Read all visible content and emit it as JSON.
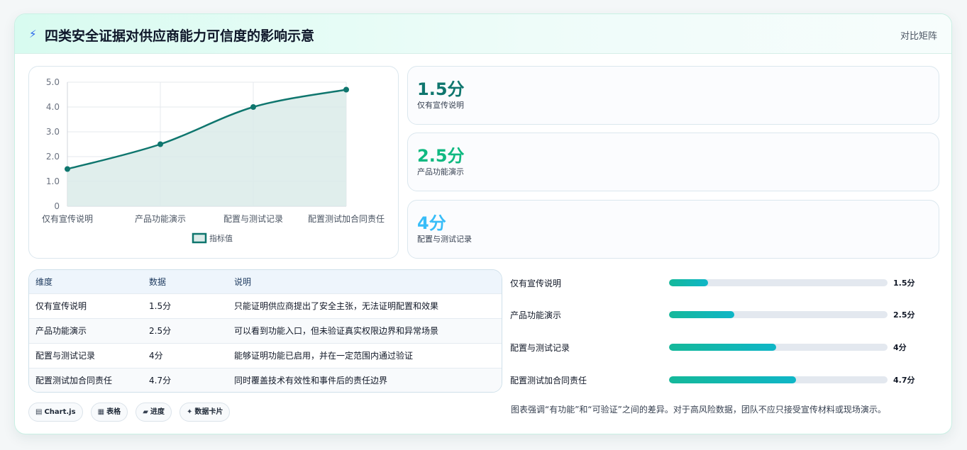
{
  "header": {
    "icon": "bolt-icon",
    "title": "四类安全证据对供应商能力可信度的影响示意",
    "tag": "对比矩阵"
  },
  "chart_data": {
    "type": "line",
    "categories": [
      "仅有宣传说明",
      "产品功能演示",
      "配置与测试记录",
      "配置测试加合同责任"
    ],
    "series": [
      {
        "name": "指标值",
        "values": [
          1.5,
          2.5,
          4,
          4.7
        ]
      }
    ],
    "ylim": [
      0,
      5
    ],
    "yticks": [
      "0",
      "1.0",
      "2.0",
      "3.0",
      "4.0",
      "5.0"
    ],
    "ytick_values": [
      0,
      1,
      2,
      3,
      4,
      5
    ],
    "grid": true,
    "legend": "bottom",
    "fill": true,
    "colors": {
      "line": "#0f766e",
      "area": "#dbebe9"
    }
  },
  "stats": [
    {
      "value": "1.5分",
      "label": "仅有宣传说明",
      "color": "#0f766e"
    },
    {
      "value": "2.5分",
      "label": "产品功能演示",
      "color": "#10b981"
    },
    {
      "value": "4分",
      "label": "配置与测试记录",
      "color": "#38bdf8"
    }
  ],
  "table": {
    "headers": [
      "维度",
      "数据",
      "说明"
    ],
    "rows": [
      [
        "仅有宣传说明",
        "1.5分",
        "只能证明供应商提出了安全主张，无法证明配置和效果"
      ],
      [
        "产品功能演示",
        "2.5分",
        "可以看到功能入口，但未验证真实权限边界和异常场景"
      ],
      [
        "配置与测试记录",
        "4分",
        "能够证明功能已启用，并在一定范围内通过验证"
      ],
      [
        "配置测试加合同责任",
        "4.7分",
        "同时覆盖技术有效性和事件后的责任边界"
      ]
    ]
  },
  "bars": [
    {
      "label": "仅有宣传说明",
      "value": "1.5分",
      "fraction": 0.18
    },
    {
      "label": "产品功能演示",
      "value": "2.5分",
      "fraction": 0.3
    },
    {
      "label": "配置与测试记录",
      "value": "4分",
      "fraction": 0.49
    },
    {
      "label": "配置测试加合同责任",
      "value": "4.7分",
      "fraction": 0.58
    }
  ],
  "chips": [
    {
      "icon": "▤",
      "label": "Chart.js"
    },
    {
      "icon": "▦",
      "label": "表格"
    },
    {
      "icon": "▰",
      "label": "进度"
    },
    {
      "icon": "✦",
      "label": "数据卡片"
    }
  ],
  "note": "图表强调“有功能”和“可验证”之间的差异。对于高风险数据，团队不应只接受宣传材料或现场演示。"
}
